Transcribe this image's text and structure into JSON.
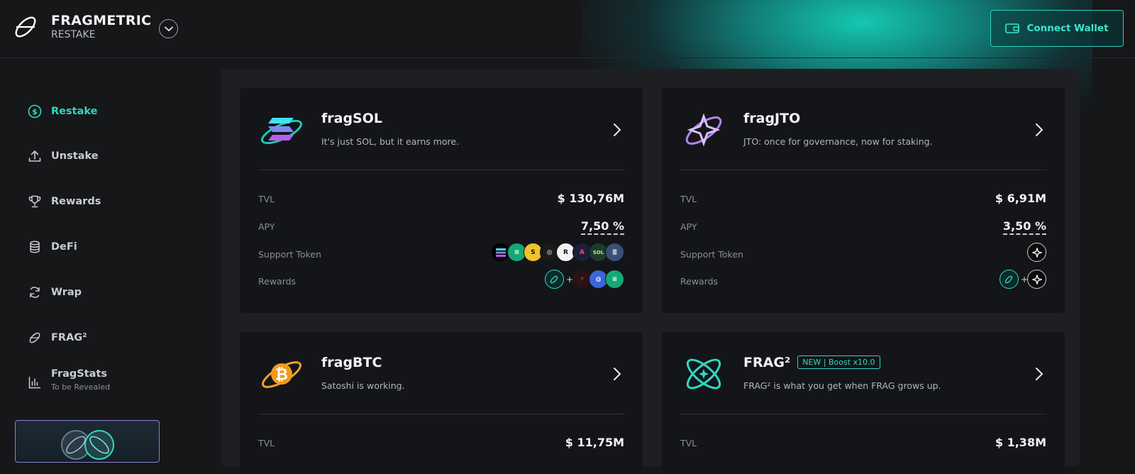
{
  "header": {
    "brand_name": "FRAGMETRIC",
    "brand_sub": "RESTAKE",
    "connect_label": "Connect Wallet"
  },
  "sidebar": {
    "items": [
      {
        "label": "Restake",
        "icon": "dollar-circle-icon",
        "active": true
      },
      {
        "label": "Unstake",
        "icon": "upload-icon"
      },
      {
        "label": "Rewards",
        "icon": "trophy-icon"
      },
      {
        "label": "DeFi",
        "icon": "database-icon"
      },
      {
        "label": "Wrap",
        "icon": "refresh-icon"
      },
      {
        "label": "FRAG²",
        "icon": "frag-squared-icon"
      },
      {
        "label": "FragStats",
        "sublabel": "To be Revealed",
        "icon": "bar-chart-icon"
      }
    ]
  },
  "cards": [
    {
      "title": "fragSOL",
      "description": "It's just SOL, but it earns more.",
      "tvl_label": "TVL",
      "tvl": "$ 130,76M",
      "apy_label": "APY",
      "apy": "7,50 %",
      "support_label": "Support Token",
      "rewards_label": "Rewards"
    },
    {
      "title": "fragJTO",
      "description": "JTO: once for governance, now for staking.",
      "tvl_label": "TVL",
      "tvl": "$ 6,91M",
      "apy_label": "APY",
      "apy": "3,50 %",
      "support_label": "Support Token",
      "rewards_label": "Rewards"
    },
    {
      "title": "fragBTC",
      "description": "Satoshi is working.",
      "tvl_label": "TVL",
      "tvl": "$ 11,75M"
    },
    {
      "title": "FRAG²",
      "badge": "NEW | Boost x10.0",
      "description": "FRAG² is what you get when FRAG grows up.",
      "tvl_label": "TVL",
      "tvl": "$ 1,38M"
    }
  ],
  "colors": {
    "accent": "#2fd8c3",
    "background": "#161719",
    "card": "#141518"
  }
}
